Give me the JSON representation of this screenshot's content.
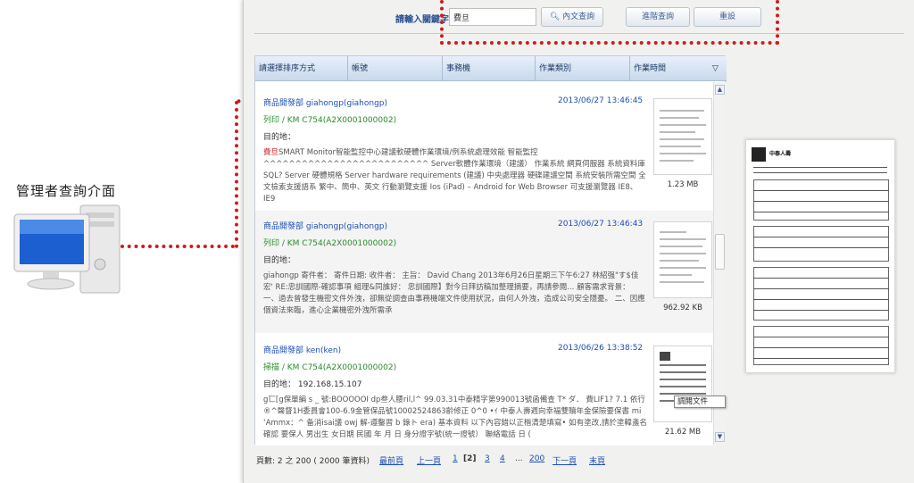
{
  "diagram": {
    "admin_label": "管理者查詢介面"
  },
  "search": {
    "label": "請輸入關鍵字",
    "input_value": "費旦",
    "btn_fulltext": "內文查詢",
    "btn_advanced": "進階查詢",
    "btn_reset": "重設"
  },
  "table": {
    "headers": [
      "請選擇排序方式",
      "帳號",
      "事務機",
      "作業類別",
      "作業時間"
    ],
    "rows": [
      {
        "user": "商品開發部 giahongp(giahongp)",
        "time": "2013/06/27 13:46:45",
        "device": "列印 / KM C754(A2X0001000002)",
        "target": "目的地：",
        "content_hl": "費旦",
        "content": "SMART Monitor智能監控中心建議軟硬體作業環境/例系統處理效能 智能監控 ^^^^^^^^^^^^^^^^^^^^^^^^^^ Server軟體作業環境（建議） 作業系統 網頁伺服器 系統資料庫 SQL? Server 硬體規格 Server hardware requirements (建議) 中央處理器 硬碟建議空間 系統安裝所需空間 全文檢索支援語系 繁中、簡中、英文 行動瀏覽支援 Ios (iPad) – Android for Web Browser 可支援瀏覽器 IE8、IE9",
        "size": "1.23 MB"
      },
      {
        "user": "商品開發部 giahongp(giahongp)",
        "time": "2013/06/27 13:46:43",
        "device": "列印 / KM C754(A2X0001000002)",
        "target": "目的地：",
        "content_hl": "",
        "content": "giahongp 寄件者： 寄件日期: 收件者： 主旨： David Chang 2013年6月26日星期三下午6:27 林紹强\"す$佳宏' RE:忠訓國際-確認事項 組理&同誰好： 忠訓國際】對今日拜訪稿加整理摘要，再請參閱... 顧客需求背景： 一、過去曾發生機密文件外洩，卻無從調查由事務機端文件使用狀況，由何人外洩，造成公司安全隱憂。 二、因應個資法來臨，進心企業機密外洩所需承",
        "size": "962.92 KB"
      },
      {
        "user": "商品開發部 ken(ken)",
        "time": "2013/06/26 13:38:52",
        "device": "掃描 / KM C754(A2X0001000002)",
        "target": "目的地： 192.168.15.107",
        "content_hl": "",
        "content": "g匸[g保單編 s _ 號:BOOOOOI dp叁人腰ril,l^ 99.03.31中泰精字第990013號函備查 T* ダ． 費LIF1? 7.1 依行®^聲督1H委員會100-6.9金管保品號10002524863齡修正 0^0 •ｲ 中泰人壽週向幸福雙贖年金保險要保書 mi ‘Ammx：^ 备消isai議 owj 解-遵鑿習 b 錄ト era) 基本資料 以下內容錯以正楷清楚填寫• 如有塗改,請於塗韓盞名確認 要保人 男出生 女日期 民國 年 月 日 身分證字號(統一證號） 聯絡電話 日 (",
        "size": "21.62 MB"
      }
    ],
    "tooltip": "調閱文件"
  },
  "pager": {
    "summary": "頁數: 2 之 200 ( 2000 筆資料)",
    "first": "最前頁",
    "prev": "上一頁",
    "p1": "1",
    "p2": "[2]",
    "p3": "3",
    "p4": "4",
    "ellipsis": "...",
    "p200": "200",
    "next": "下一頁",
    "last": "末頁"
  },
  "preview": {
    "title": "中泰人壽"
  }
}
